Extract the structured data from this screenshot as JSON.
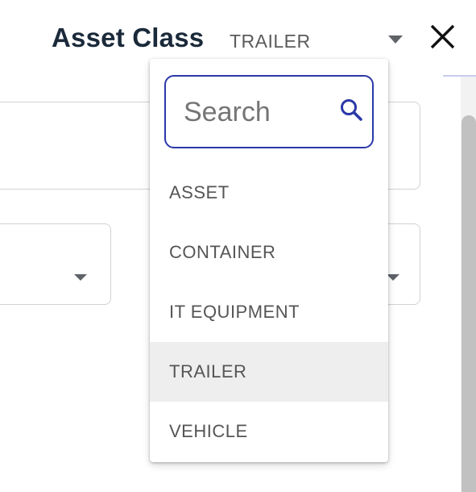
{
  "header": {
    "field_label": "Asset Class",
    "selected_value": "TRAILER"
  },
  "dropdown": {
    "search": {
      "placeholder": "Search",
      "value": ""
    },
    "options": [
      {
        "label": "ASSET",
        "selected": false
      },
      {
        "label": "CONTAINER",
        "selected": false
      },
      {
        "label": "IT EQUIPMENT",
        "selected": false
      },
      {
        "label": "TRAILER",
        "selected": true
      },
      {
        "label": "VEHICLE",
        "selected": false
      }
    ]
  },
  "icons": {
    "search": "search-icon",
    "close": "close-icon",
    "dropdown_caret": "caret-down-icon"
  },
  "colors": {
    "accent": "#2a38a8",
    "label_text": "#1b2a3a",
    "option_text": "#555555",
    "selected_option_bg": "#eeeeee"
  }
}
